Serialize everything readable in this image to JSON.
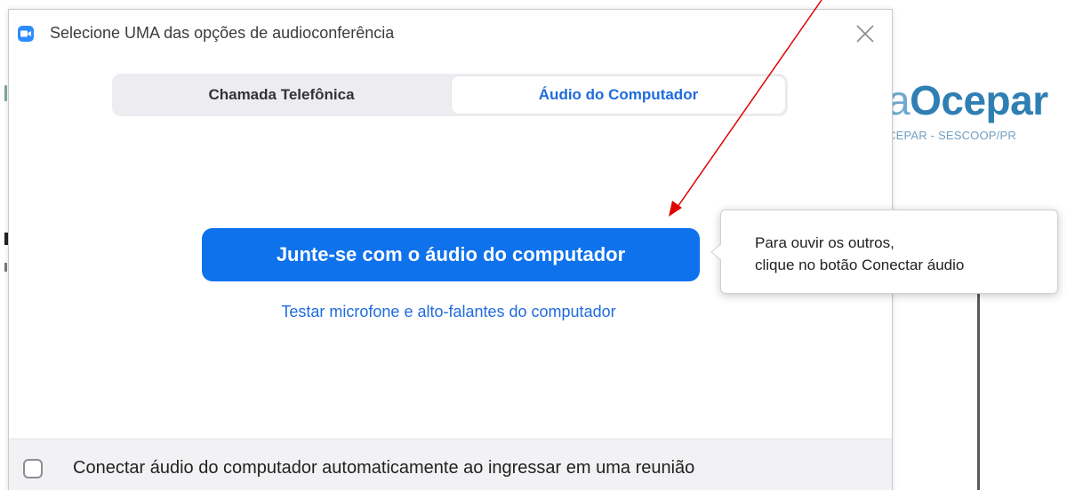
{
  "background": {
    "logo_prefix": "a",
    "logo_main": "Ocepar",
    "logo_sub": "CEPAR - SESCOOP/PR"
  },
  "dialog": {
    "title": "Selecione UMA das opções de audioconferência",
    "app_icon": "video-camera-icon",
    "close_icon": "close-icon",
    "tabs": [
      {
        "label": "Chamada Telefônica",
        "selected": false
      },
      {
        "label": "Áudio do Computador",
        "selected": true
      }
    ],
    "join_button_label": "Junte-se com o áudio do computador",
    "test_link_label": "Testar microfone e alto-falantes do computador",
    "auto_connect": {
      "label": "Conectar áudio do computador automaticamente ao ingressar em uma reunião",
      "checked": false
    }
  },
  "tooltip": {
    "line1": "Para ouvir os outros,",
    "line2": "clique no botão Conectar áudio"
  },
  "colors": {
    "accent": "#0e72ed",
    "link": "#1f6bdc",
    "annotation": "#e00000",
    "logo": "#2f7fb4"
  }
}
